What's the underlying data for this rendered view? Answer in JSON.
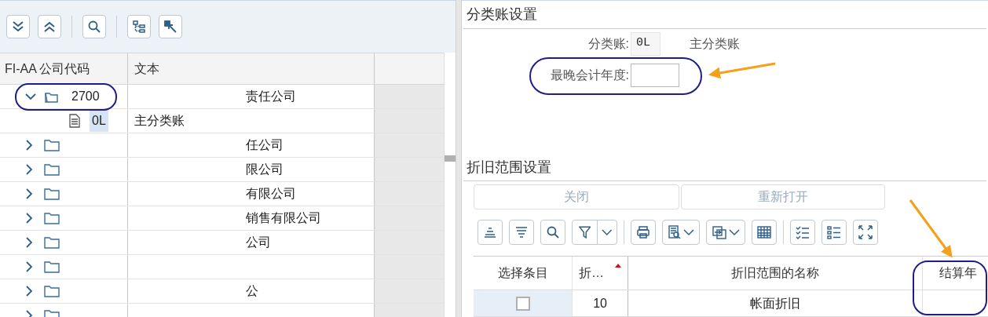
{
  "tree": {
    "columns": [
      "FI-AA 公司代码",
      "文本"
    ],
    "nodes": [
      {
        "kind": "folder",
        "code": "2700",
        "text": "责任公司",
        "expanded": true,
        "selected": false,
        "children": [
          {
            "kind": "document",
            "code": "0L",
            "text": "主分类账",
            "selected": true
          }
        ]
      },
      {
        "kind": "folder",
        "text": "任公司",
        "expanded": false,
        "selected": false
      },
      {
        "kind": "folder",
        "text": "限公司",
        "expanded": false,
        "selected": false
      },
      {
        "kind": "folder",
        "text": "有限公司",
        "expanded": false,
        "selected": false
      },
      {
        "kind": "folder",
        "text": "销售有限公司",
        "expanded": false,
        "selected": false
      },
      {
        "kind": "folder",
        "text": "公司",
        "expanded": false,
        "selected": false
      },
      {
        "kind": "folder",
        "expanded": false,
        "selected": false
      },
      {
        "kind": "folder",
        "text": "公",
        "expanded": false,
        "selected": false
      },
      {
        "kind": "folder",
        "expanded": false,
        "selected": false
      }
    ]
  },
  "ledger_settings": {
    "title": "分类账设置",
    "fields": [
      {
        "label": "分类账:",
        "value": "0L",
        "description": "主分类账"
      },
      {
        "label": "最晚会计年度:"
      }
    ]
  },
  "depreciation_settings": {
    "title": "折旧范围设置",
    "buttons": [
      {
        "label": "关闭",
        "disabled": true
      },
      {
        "label": "重新打开",
        "disabled": true
      }
    ],
    "table": {
      "columns": [
        {
          "label": "选择条目",
          "sorted": false
        },
        {
          "label": "折…",
          "sorted": true
        },
        {
          "label": "折旧范围的名称",
          "sorted": false
        },
        {
          "label": "结算年",
          "sorted": false
        }
      ],
      "rows": [
        {
          "checked": false,
          "column_2": "10",
          "name": "帐面折旧"
        }
      ]
    }
  }
}
